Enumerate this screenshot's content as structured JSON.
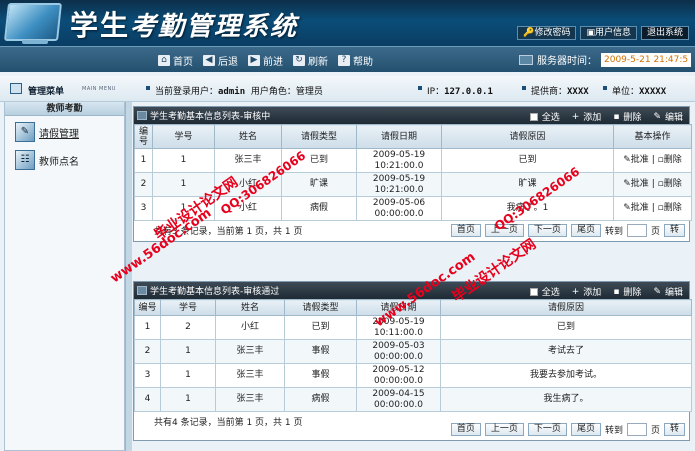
{
  "header": {
    "title_prefix": "学生",
    "title_rest": "考勤管理系统",
    "buttons": {
      "change_password": "修改密码",
      "user_info": "用户信息",
      "logout": "退出系统"
    }
  },
  "toolbar": {
    "home": "首页",
    "back": "后退",
    "forward": "前进",
    "refresh": "刷新",
    "help": "帮助",
    "server_time_label": "服务器时间：",
    "server_time": "2009-5-21 21:47:5"
  },
  "infobar": {
    "menu_title": "管理菜单",
    "menu_sub": "MAIN MENU",
    "current_user_label": "当前登录用户：",
    "current_user": "admin",
    "role_label": "用户角色：",
    "role": "管理员",
    "ip_label": "IP：",
    "ip": "127.0.0.1",
    "provider_label": "提供商：",
    "provider": "XXXX",
    "unit_label": "单位：",
    "unit": "XXXXX"
  },
  "sidebar": {
    "section": "教师考勤",
    "items": [
      {
        "label": "请假管理"
      },
      {
        "label": "教师点名"
      }
    ]
  },
  "panel1": {
    "title": "学生考勤基本信息列表-审核中",
    "actions": {
      "select_all": "全选",
      "add": "添加",
      "delete": "删除",
      "edit": "编辑"
    },
    "headers": [
      "编号",
      "学号",
      "姓名",
      "请假类型",
      "请假日期",
      "请假原因",
      "基本操作"
    ],
    "rows": [
      {
        "id": "1",
        "sno": "1",
        "name": "张三丰",
        "type": "已到",
        "date1": "2009-05-19",
        "date2": "10:21:00.0",
        "reason": "已到"
      },
      {
        "id": "2",
        "sno": "1",
        "name": "小红",
        "type": "旷课",
        "date1": "2009-05-19",
        "date2": "10:21:00.0",
        "reason": "旷课"
      },
      {
        "id": "3",
        "sno": "1",
        "name": "小红",
        "type": "病假",
        "date1": "2009-05-06",
        "date2": "00:00:00.0",
        "reason": "我病了。1"
      }
    ],
    "op_approve": "批准",
    "op_delete": "删除",
    "op_sep": "|",
    "pager": {
      "info": "共有3 条记录，当前第 1 页，共 1 页",
      "first": "首页",
      "prev": "上一页",
      "next": "下一页",
      "last": "尾页",
      "goto": "转到",
      "page": "页",
      "go": "转"
    }
  },
  "panel2": {
    "title": "学生考勤基本信息列表-审核通过",
    "actions": {
      "select_all": "全选",
      "add": "添加",
      "delete": "删除",
      "edit": "编辑"
    },
    "headers": [
      "编号",
      "学号",
      "姓名",
      "请假类型",
      "请假日期",
      "请假原因"
    ],
    "rows": [
      {
        "id": "1",
        "sno": "2",
        "name": "小红",
        "type": "已到",
        "date1": "2009-05-19",
        "date2": "10:11:00.0",
        "reason": "已到"
      },
      {
        "id": "2",
        "sno": "1",
        "name": "张三丰",
        "type": "事假",
        "date1": "2009-05-03",
        "date2": "00:00:00.0",
        "reason": "考试去了"
      },
      {
        "id": "3",
        "sno": "1",
        "name": "张三丰",
        "type": "事假",
        "date1": "2009-05-12",
        "date2": "00:00:00.0",
        "reason": "我要去参加考试。"
      },
      {
        "id": "4",
        "sno": "1",
        "name": "张三丰",
        "type": "病假",
        "date1": "2009-04-15",
        "date2": "00:00:00.0",
        "reason": "我生病了。"
      }
    ],
    "pager": {
      "info": "共有4 条记录，当前第 1 页，共 1 页",
      "first": "首页",
      "prev": "上一页",
      "next": "下一页",
      "last": "尾页",
      "goto": "转到",
      "page": "页",
      "go": "转"
    }
  },
  "watermarks": {
    "site": "www.56doc.com",
    "qq": "QQ:306826066",
    "brand": "毕业设计论文网"
  },
  "colors": {
    "watermark": "#e8001c",
    "server_time": "#d07000",
    "header": "#0a4d78"
  }
}
